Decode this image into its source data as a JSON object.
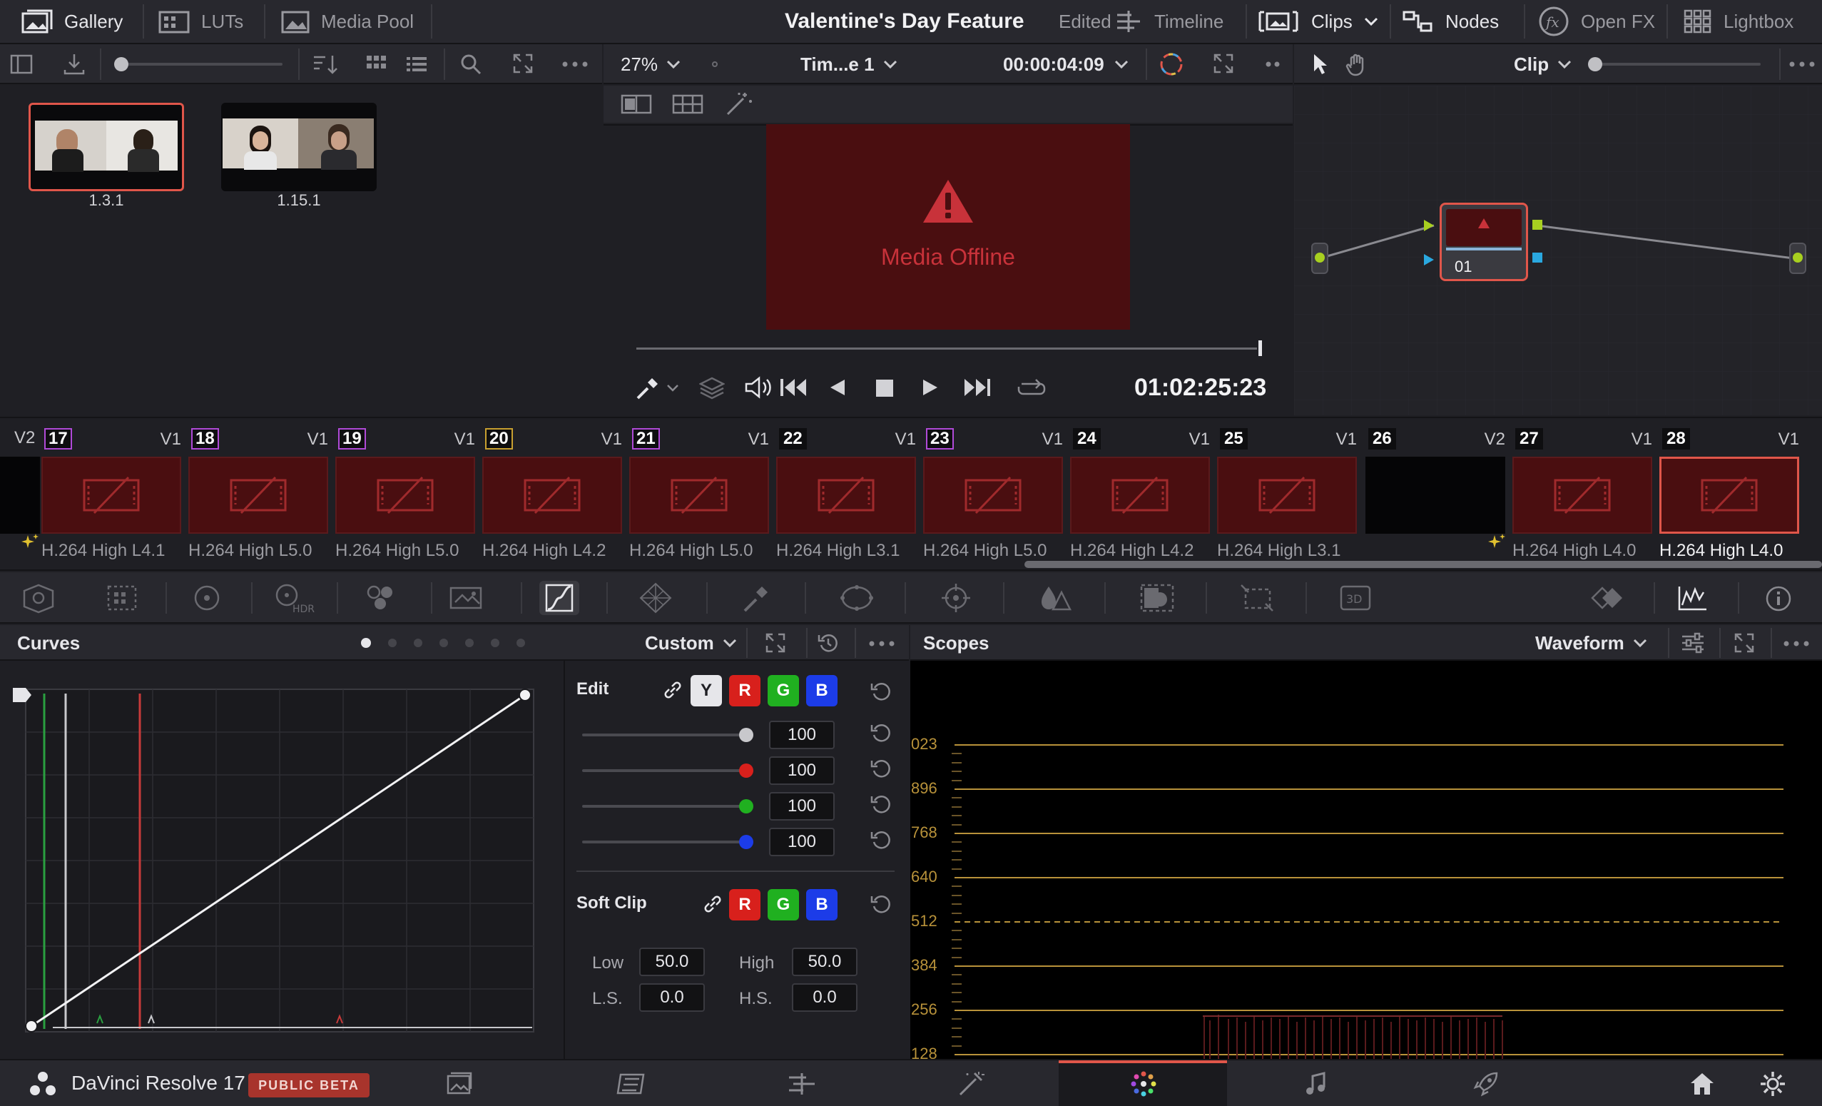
{
  "topbar": {
    "gallery": "Gallery",
    "luts": "LUTs",
    "media_pool": "Media Pool",
    "project_title": "Valentine's Day Feature",
    "edited": "Edited",
    "timeline": "Timeline",
    "clips": "Clips",
    "nodes": "Nodes",
    "open_fx": "Open FX",
    "lightbox": "Lightbox"
  },
  "gallery": {
    "stills": [
      {
        "label": "1.3.1",
        "selected": true
      },
      {
        "label": "1.15.1",
        "selected": false
      }
    ]
  },
  "viewer": {
    "zoom": "27%",
    "timeline_name": "Tim...e 1",
    "timecode_top": "00:00:04:09",
    "offline_text": "Media Offline",
    "timecode": "01:02:25:23"
  },
  "nodes": {
    "mode": "Clip",
    "node_label": "01"
  },
  "clips": [
    {
      "num": "17",
      "track": "V1",
      "codec": "H.264 High L4.1",
      "num_color": "#b04ad8",
      "fx": true
    },
    {
      "num": "18",
      "track": "V1",
      "codec": "H.264 High L5.0",
      "num_color": "#b04ad8",
      "fx": false
    },
    {
      "num": "19",
      "track": "V1",
      "codec": "H.264 High L5.0",
      "num_color": "#b04ad8",
      "fx": false
    },
    {
      "num": "20",
      "track": "V1",
      "codec": "H.264 High L4.2",
      "num_color": "#c8a030",
      "fx": false
    },
    {
      "num": "21",
      "track": "V1",
      "codec": "H.264 High L5.0",
      "num_color": "#b04ad8",
      "fx": false
    },
    {
      "num": "22",
      "track": "V1",
      "codec": "H.264 High L3.1",
      "num_color": "#0e0e10",
      "fx": false
    },
    {
      "num": "23",
      "track": "V1",
      "codec": "H.264 High L5.0",
      "num_color": "#b04ad8",
      "fx": false
    },
    {
      "num": "24",
      "track": "V1",
      "codec": "H.264 High L4.2",
      "num_color": "#0e0e10",
      "fx": false
    },
    {
      "num": "25",
      "track": "V1",
      "codec": "H.264 High L3.1",
      "num_color": "#0e0e10",
      "fx": false
    },
    {
      "num": "26",
      "track": "V2",
      "codec": "",
      "num_color": "#0e0e10",
      "fx": true,
      "black": true
    },
    {
      "num": "27",
      "track": "V1",
      "codec": "H.264 High L4.0",
      "num_color": "#0e0e10",
      "fx": false
    },
    {
      "num": "28",
      "track": "V1",
      "codec": "H.264 High L4.0",
      "num_color": "#0e0e10",
      "fx": false,
      "selected": true
    }
  ],
  "first_track": "V2",
  "curves": {
    "title": "Curves",
    "preset": "Custom",
    "edit_label": "Edit",
    "channels": [
      "Y",
      "R",
      "G",
      "B"
    ],
    "intensity": [
      "100",
      "100",
      "100",
      "100"
    ],
    "soft_clip_label": "Soft Clip",
    "low_label": "Low",
    "low_value": "50.0",
    "high_label": "High",
    "high_value": "50.0",
    "ls_label": "L.S.",
    "ls_value": "0.0",
    "hs_label": "H.S.",
    "hs_value": "0.0"
  },
  "scopes": {
    "title": "Scopes",
    "mode": "Waveform",
    "ticks": [
      "023",
      "896",
      "768",
      "640",
      "512",
      "384",
      "256",
      "128"
    ]
  },
  "bottombar": {
    "app_name": "DaVinci Resolve 17",
    "beta_badge": "PUBLIC BETA"
  },
  "colors": {
    "accent_red": "#e0564a",
    "offline_bg": "#4a0e10",
    "scope_line": "#b8923a"
  }
}
